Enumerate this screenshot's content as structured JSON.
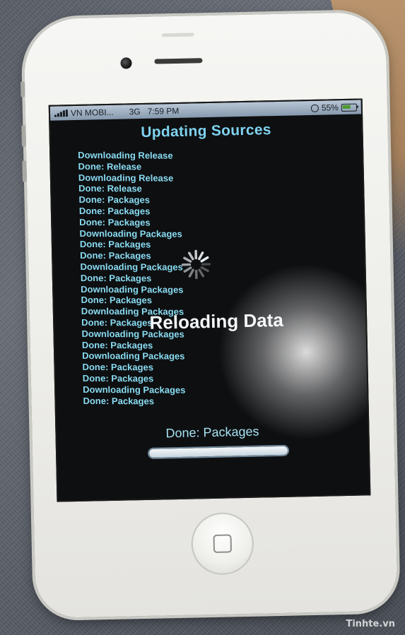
{
  "status_bar": {
    "carrier": "VN MOBI...",
    "network": "3G",
    "time": "7:59 PM",
    "battery": "55%",
    "battery_level": 0.55
  },
  "screen": {
    "title": "Updating Sources",
    "log_lines": [
      "Downloading Release",
      "Done: Release",
      "Downloading Release",
      "Done: Release",
      "Done: Packages",
      "Done: Packages",
      "Done: Packages",
      "Downloading Packages",
      "Done: Packages",
      "Done: Packages",
      "Downloading Packages",
      "Done: Packages",
      "Downloading Packages",
      "Done: Packages",
      "Downloading Packages",
      "Done: Packages",
      "Downloading Packages",
      "Done: Packages",
      "Downloading Packages",
      "Done: Packages",
      "Done: Packages",
      "Downloading Packages",
      "Done: Packages"
    ],
    "hud_label": "Reloading Data",
    "progress_status": "Done: Packages",
    "progress_value": 1.0
  },
  "watermark": "Tinhte.vn",
  "icons": {
    "spinner": "activity-spinner-icon",
    "home": "home-square-icon"
  },
  "colors": {
    "log_text": "#89dcf2",
    "title_text": "#7fd3f0",
    "screen_bg": "#0e0f11"
  }
}
